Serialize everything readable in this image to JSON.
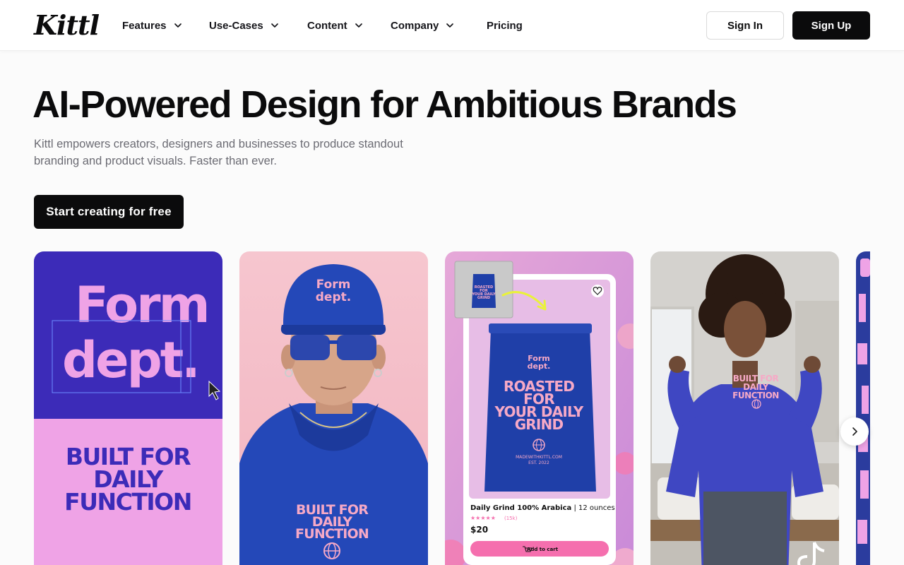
{
  "header": {
    "logo": "Kittl",
    "nav": [
      {
        "label": "Features",
        "has_dropdown": true
      },
      {
        "label": "Use-Cases",
        "has_dropdown": true
      },
      {
        "label": "Content",
        "has_dropdown": true
      },
      {
        "label": "Company",
        "has_dropdown": true
      },
      {
        "label": "Pricing",
        "has_dropdown": false
      }
    ],
    "sign_in": "Sign In",
    "sign_up": "Sign Up"
  },
  "hero": {
    "title": "AI-Powered Design for Ambitious Brands",
    "subtitle": "Kittl empowers creators, designers and businesses to produce standout branding and product visuals. Faster than ever.",
    "cta": "Start creating for free"
  },
  "carousel": {
    "cards": [
      {
        "name": "form-dept-brand-card",
        "logo_line1": "Form",
        "logo_line2": "dept.",
        "tagline_lines": [
          "BUILT FOR",
          "DAILY",
          "FUNCTION"
        ]
      },
      {
        "name": "hoodie-model-card",
        "cap_logo_line1": "Form",
        "cap_logo_line2": "dept.",
        "tagline_lines": [
          "BUILT FOR",
          "DAILY",
          "FUNCTION"
        ]
      },
      {
        "name": "coffee-product-card",
        "bag_logo_line1": "Form",
        "bag_logo_line2": "dept.",
        "bag_lines": [
          "ROASTED",
          "FOR",
          "YOUR DAILY",
          "GRIND"
        ],
        "bag_footer": "MADEWITHKITTL.COM",
        "bag_est": "EST. 2022",
        "thumb_lines": [
          "ROASTED",
          "FOR",
          "YOUR DAILY",
          "GRIND"
        ],
        "product_title": "Daily Grind 100% Arabica",
        "product_size": "| 12 ounces",
        "rating_count": "(15k)",
        "price": "$20",
        "add_to_cart": "Add to cart"
      },
      {
        "name": "sweatshirt-model-card",
        "shirt_lines": [
          "BUILT FOR",
          "DAILY",
          "FUNCTION"
        ]
      },
      {
        "name": "partial-card"
      }
    ],
    "colors": {
      "brand_blue": "#3c2bb8",
      "brand_pink": "#efa3e6",
      "bag_blue": "#1f3fa8",
      "cart_pink": "#f56fae"
    }
  }
}
